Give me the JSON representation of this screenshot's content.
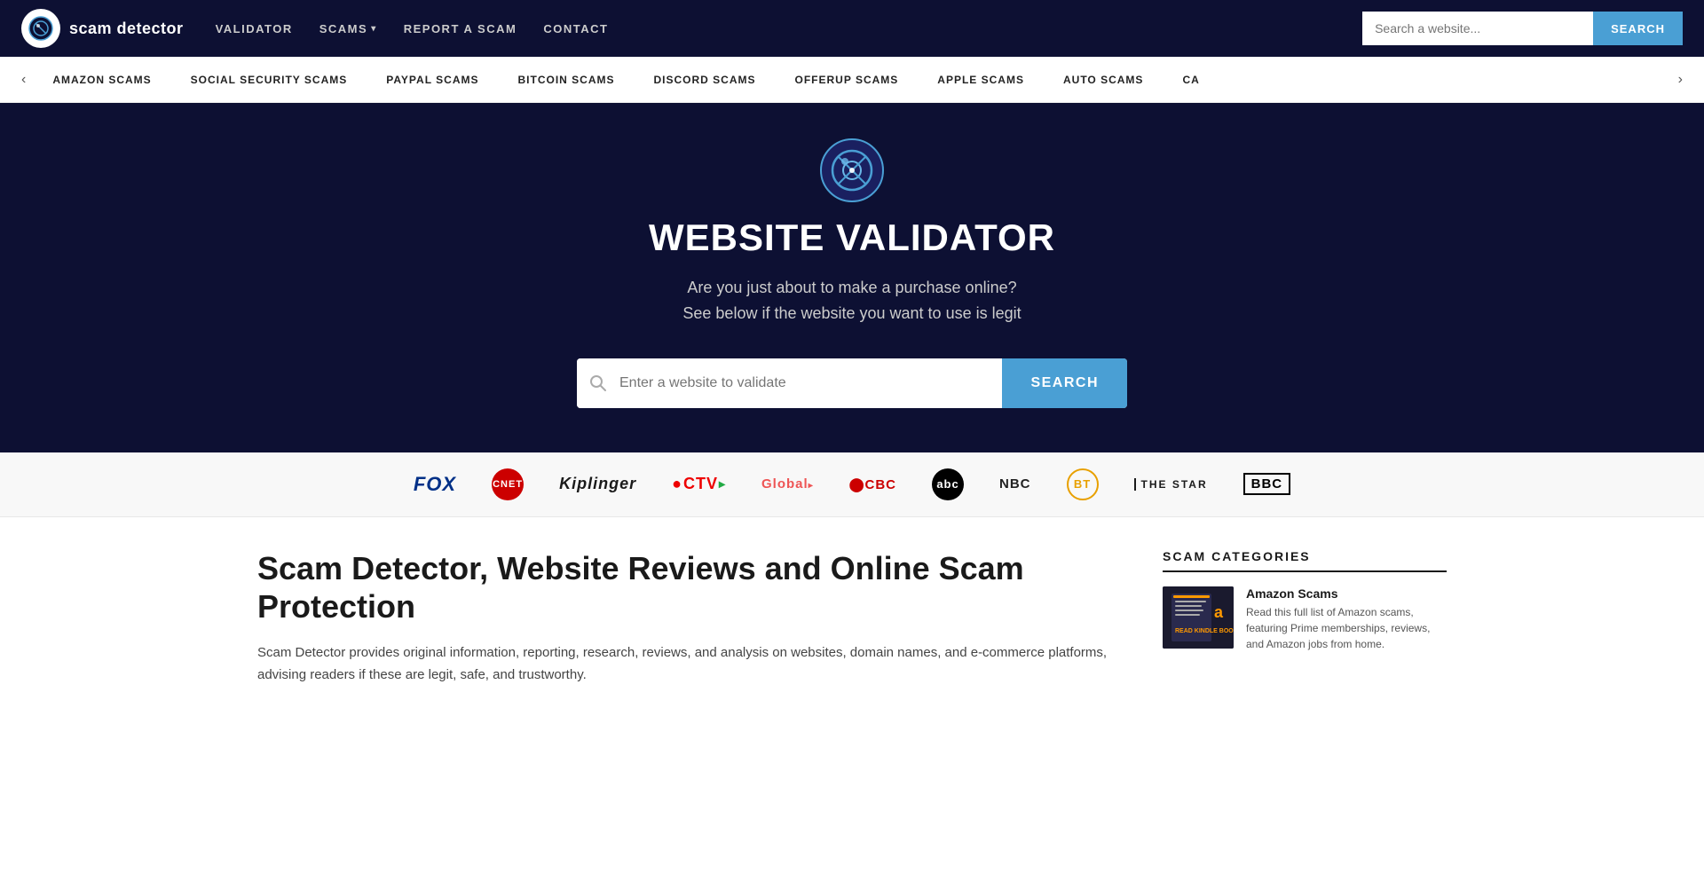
{
  "navbar": {
    "logo_icon": "🔍",
    "logo_text": "scam detector",
    "links": [
      {
        "label": "VALIDATOR",
        "dropdown": false
      },
      {
        "label": "SCAMS",
        "dropdown": true
      },
      {
        "label": "REPORT A SCAM",
        "dropdown": false
      },
      {
        "label": "CONTACT",
        "dropdown": false
      }
    ],
    "search_placeholder": "Search a website...",
    "search_btn": "SEARCH"
  },
  "scam_bar": {
    "items": [
      "AMAZON SCAMS",
      "SOCIAL SECURITY SCAMS",
      "PAYPAL SCAMS",
      "BITCOIN SCAMS",
      "DISCORD SCAMS",
      "OFFERUP SCAMS",
      "APPLE SCAMS",
      "AUTO SCAMS",
      "CA"
    ]
  },
  "hero": {
    "title": "WEBSITE VALIDATOR",
    "subtitle_line1": "Are you just about to make a purchase online?",
    "subtitle_line2": "See below if the website you want to use is legit",
    "search_placeholder": "Enter a website to validate",
    "search_btn": "SEARCH"
  },
  "media": {
    "logos": [
      {
        "name": "FOX",
        "style": "fox"
      },
      {
        "name": "CNET",
        "style": "cnet"
      },
      {
        "name": "Kiplinger",
        "style": "kiplinger"
      },
      {
        "name": "CTV",
        "style": "ctv"
      },
      {
        "name": "Global",
        "style": "global"
      },
      {
        "name": "CBC",
        "style": "cbc"
      },
      {
        "name": "abc",
        "style": "abc"
      },
      {
        "name": "NBC",
        "style": "nbc"
      },
      {
        "name": "BT",
        "style": "bt"
      },
      {
        "name": "THE STAR",
        "style": "thestar"
      },
      {
        "name": "BBC",
        "style": "bbc"
      }
    ]
  },
  "main": {
    "title": "Scam Detector, Website Reviews and Online Scam Protection",
    "description": "Scam Detector provides original information, reporting, research, reviews, and analysis on websites, domain names, and e-commerce platforms, advising readers if these are legit, safe, and trustworthy."
  },
  "sidebar": {
    "title": "SCAM CATEGORIES",
    "items": [
      {
        "title": "Amazon Scams",
        "description": "Read this full list of Amazon scams, featuring Prime memberships, reviews, and Amazon jobs from home.",
        "img_label": "Amazon"
      }
    ]
  }
}
